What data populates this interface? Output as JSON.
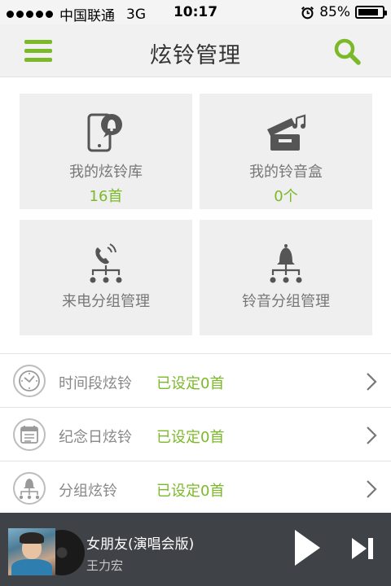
{
  "status_bar": {
    "carrier": "中国联通",
    "network": "3G",
    "time": "10:17",
    "battery": "85%",
    "battery_level": 0.85
  },
  "nav": {
    "title": "炫铃管理",
    "menu_icon": "hamburger-icon",
    "search_icon": "search-icon"
  },
  "grid": [
    {
      "label": "我的炫铃库",
      "count": "16首",
      "icon": "phone-ringtone-icon"
    },
    {
      "label": "我的铃音盒",
      "count": "0个",
      "icon": "music-box-icon"
    },
    {
      "label": "来电分组管理",
      "icon": "call-group-icon"
    },
    {
      "label": "铃音分组管理",
      "icon": "bell-group-icon"
    }
  ],
  "list": [
    {
      "label": "时间段炫铃",
      "status": "已设定0首",
      "icon": "clock-icon"
    },
    {
      "label": "纪念日炫铃",
      "status": "已设定0首",
      "icon": "calendar-icon"
    },
    {
      "label": "分组炫铃",
      "status": "已设定0首",
      "icon": "group-bell-icon"
    }
  ],
  "player": {
    "song": "女朋友(演唱会版)",
    "artist": "王力宏"
  },
  "colors": {
    "accent": "#7cb92a",
    "tile_bg": "#efefef",
    "player_bg": "#3f4247"
  }
}
